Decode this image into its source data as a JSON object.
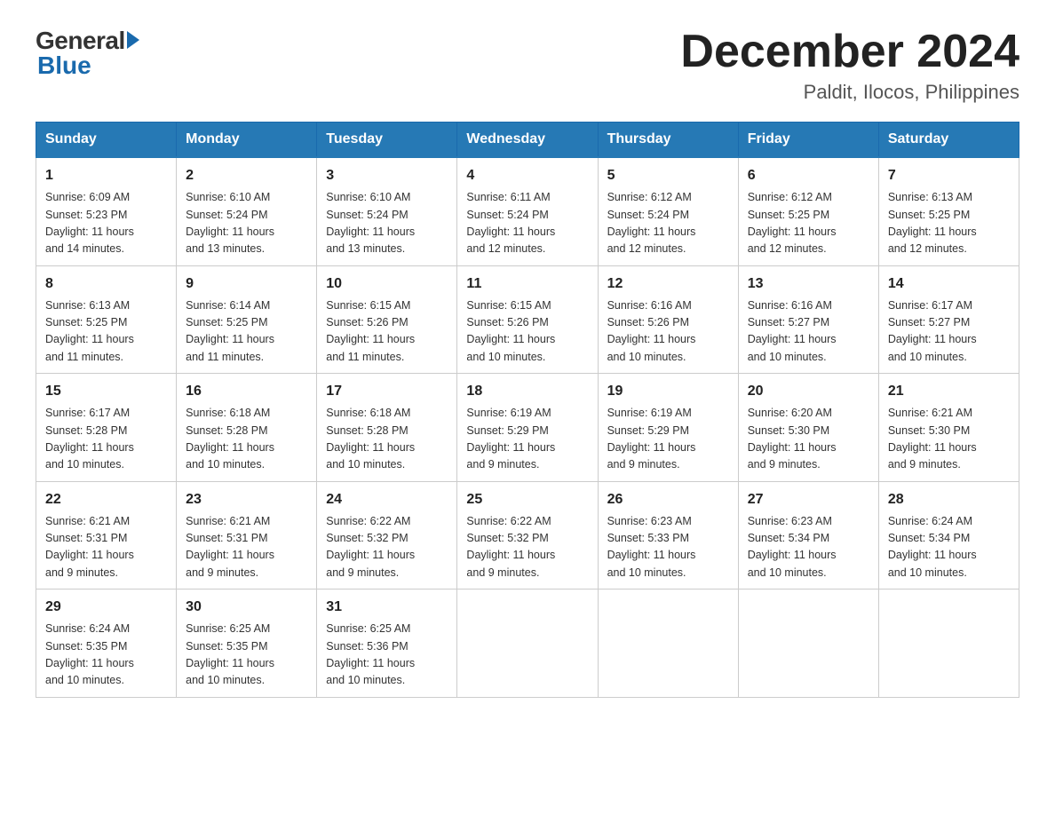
{
  "header": {
    "logo_general": "General",
    "logo_blue": "Blue",
    "month_year": "December 2024",
    "location": "Paldit, Ilocos, Philippines"
  },
  "days_of_week": [
    "Sunday",
    "Monday",
    "Tuesday",
    "Wednesday",
    "Thursday",
    "Friday",
    "Saturday"
  ],
  "weeks": [
    [
      {
        "day": "1",
        "sunrise": "6:09 AM",
        "sunset": "5:23 PM",
        "daylight": "11 hours and 14 minutes."
      },
      {
        "day": "2",
        "sunrise": "6:10 AM",
        "sunset": "5:24 PM",
        "daylight": "11 hours and 13 minutes."
      },
      {
        "day": "3",
        "sunrise": "6:10 AM",
        "sunset": "5:24 PM",
        "daylight": "11 hours and 13 minutes."
      },
      {
        "day": "4",
        "sunrise": "6:11 AM",
        "sunset": "5:24 PM",
        "daylight": "11 hours and 12 minutes."
      },
      {
        "day": "5",
        "sunrise": "6:12 AM",
        "sunset": "5:24 PM",
        "daylight": "11 hours and 12 minutes."
      },
      {
        "day": "6",
        "sunrise": "6:12 AM",
        "sunset": "5:25 PM",
        "daylight": "11 hours and 12 minutes."
      },
      {
        "day": "7",
        "sunrise": "6:13 AM",
        "sunset": "5:25 PM",
        "daylight": "11 hours and 12 minutes."
      }
    ],
    [
      {
        "day": "8",
        "sunrise": "6:13 AM",
        "sunset": "5:25 PM",
        "daylight": "11 hours and 11 minutes."
      },
      {
        "day": "9",
        "sunrise": "6:14 AM",
        "sunset": "5:25 PM",
        "daylight": "11 hours and 11 minutes."
      },
      {
        "day": "10",
        "sunrise": "6:15 AM",
        "sunset": "5:26 PM",
        "daylight": "11 hours and 11 minutes."
      },
      {
        "day": "11",
        "sunrise": "6:15 AM",
        "sunset": "5:26 PM",
        "daylight": "11 hours and 10 minutes."
      },
      {
        "day": "12",
        "sunrise": "6:16 AM",
        "sunset": "5:26 PM",
        "daylight": "11 hours and 10 minutes."
      },
      {
        "day": "13",
        "sunrise": "6:16 AM",
        "sunset": "5:27 PM",
        "daylight": "11 hours and 10 minutes."
      },
      {
        "day": "14",
        "sunrise": "6:17 AM",
        "sunset": "5:27 PM",
        "daylight": "11 hours and 10 minutes."
      }
    ],
    [
      {
        "day": "15",
        "sunrise": "6:17 AM",
        "sunset": "5:28 PM",
        "daylight": "11 hours and 10 minutes."
      },
      {
        "day": "16",
        "sunrise": "6:18 AM",
        "sunset": "5:28 PM",
        "daylight": "11 hours and 10 minutes."
      },
      {
        "day": "17",
        "sunrise": "6:18 AM",
        "sunset": "5:28 PM",
        "daylight": "11 hours and 10 minutes."
      },
      {
        "day": "18",
        "sunrise": "6:19 AM",
        "sunset": "5:29 PM",
        "daylight": "11 hours and 9 minutes."
      },
      {
        "day": "19",
        "sunrise": "6:19 AM",
        "sunset": "5:29 PM",
        "daylight": "11 hours and 9 minutes."
      },
      {
        "day": "20",
        "sunrise": "6:20 AM",
        "sunset": "5:30 PM",
        "daylight": "11 hours and 9 minutes."
      },
      {
        "day": "21",
        "sunrise": "6:21 AM",
        "sunset": "5:30 PM",
        "daylight": "11 hours and 9 minutes."
      }
    ],
    [
      {
        "day": "22",
        "sunrise": "6:21 AM",
        "sunset": "5:31 PM",
        "daylight": "11 hours and 9 minutes."
      },
      {
        "day": "23",
        "sunrise": "6:21 AM",
        "sunset": "5:31 PM",
        "daylight": "11 hours and 9 minutes."
      },
      {
        "day": "24",
        "sunrise": "6:22 AM",
        "sunset": "5:32 PM",
        "daylight": "11 hours and 9 minutes."
      },
      {
        "day": "25",
        "sunrise": "6:22 AM",
        "sunset": "5:32 PM",
        "daylight": "11 hours and 9 minutes."
      },
      {
        "day": "26",
        "sunrise": "6:23 AM",
        "sunset": "5:33 PM",
        "daylight": "11 hours and 10 minutes."
      },
      {
        "day": "27",
        "sunrise": "6:23 AM",
        "sunset": "5:34 PM",
        "daylight": "11 hours and 10 minutes."
      },
      {
        "day": "28",
        "sunrise": "6:24 AM",
        "sunset": "5:34 PM",
        "daylight": "11 hours and 10 minutes."
      }
    ],
    [
      {
        "day": "29",
        "sunrise": "6:24 AM",
        "sunset": "5:35 PM",
        "daylight": "11 hours and 10 minutes."
      },
      {
        "day": "30",
        "sunrise": "6:25 AM",
        "sunset": "5:35 PM",
        "daylight": "11 hours and 10 minutes."
      },
      {
        "day": "31",
        "sunrise": "6:25 AM",
        "sunset": "5:36 PM",
        "daylight": "11 hours and 10 minutes."
      },
      null,
      null,
      null,
      null
    ]
  ],
  "labels": {
    "sunrise": "Sunrise:",
    "sunset": "Sunset:",
    "daylight": "Daylight:"
  }
}
